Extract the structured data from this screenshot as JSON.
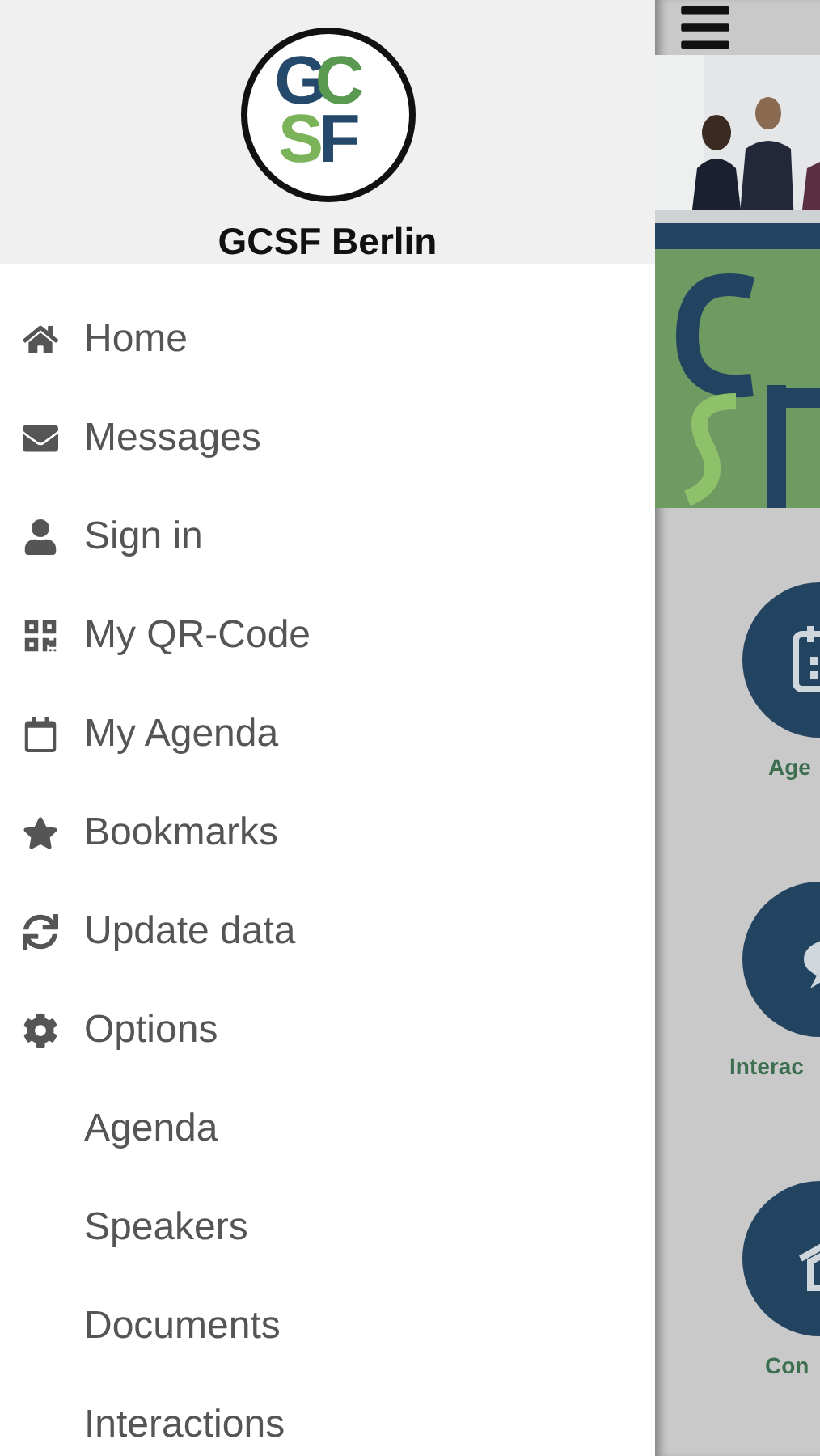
{
  "drawer": {
    "logo_letters": [
      "G",
      "C",
      "S",
      "F"
    ],
    "title": "GCSF Berlin",
    "items": [
      {
        "kind": "main",
        "label": "Home"
      },
      {
        "kind": "main",
        "label": "Messages"
      },
      {
        "kind": "main",
        "label": "Sign in"
      },
      {
        "kind": "main",
        "label": "My QR-Code"
      },
      {
        "kind": "main",
        "label": "My Agenda"
      },
      {
        "kind": "main",
        "label": "Bookmarks"
      },
      {
        "kind": "main",
        "label": "Update data"
      },
      {
        "kind": "main",
        "label": "Options"
      },
      {
        "kind": "sub",
        "label": "Agenda"
      },
      {
        "kind": "sub",
        "label": "Speakers"
      },
      {
        "kind": "sub",
        "label": "Documents"
      },
      {
        "kind": "sub",
        "label": "Interactions"
      }
    ]
  },
  "content": {
    "tiles": [
      {
        "label": "Age"
      },
      {
        "label": "Interac"
      },
      {
        "label": "Con"
      }
    ]
  }
}
